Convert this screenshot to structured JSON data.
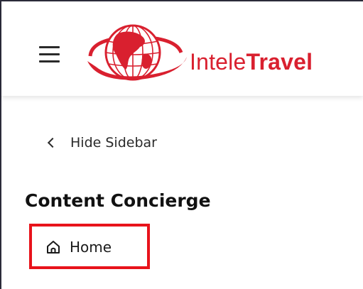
{
  "header": {
    "menu_icon": "hamburger-menu-icon",
    "logo": {
      "icon": "globe-ring-logo-icon",
      "text_light": "Intele",
      "text_bold": "Travel",
      "color": "#d9202f"
    }
  },
  "sidebar": {
    "hide_label": "Hide Sidebar",
    "hide_icon": "chevron-left-icon",
    "section_title": "Content Concierge",
    "items": [
      {
        "label": "Home",
        "icon": "home-icon"
      }
    ]
  },
  "highlight_color": "#e8131b"
}
